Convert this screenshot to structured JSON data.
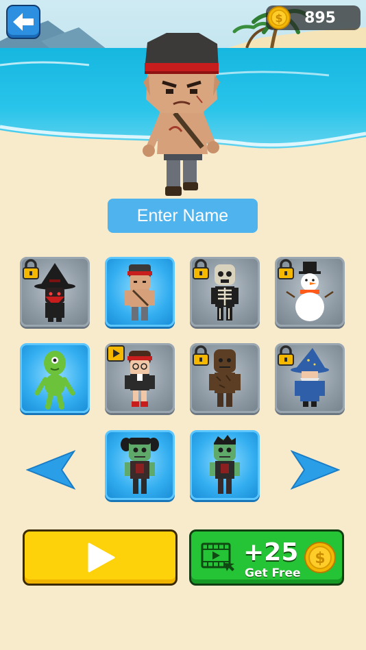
{
  "header": {
    "coin_count": "895",
    "back_icon": "arrow-left-icon",
    "coin_icon": "coin-icon"
  },
  "hero": {
    "character": "bandana-fighter"
  },
  "name_field": {
    "label": "Enter Name"
  },
  "characters": [
    {
      "name": "bandit-witch",
      "state": "locked",
      "unlock": "coins"
    },
    {
      "name": "bandana-fighter",
      "state": "selected",
      "unlock": ""
    },
    {
      "name": "skeleton",
      "state": "locked",
      "unlock": "coins"
    },
    {
      "name": "snowman",
      "state": "locked",
      "unlock": "coins"
    },
    {
      "name": "green-alien",
      "state": "unlocked",
      "unlock": ""
    },
    {
      "name": "schoolgirl",
      "state": "locked",
      "unlock": "video"
    },
    {
      "name": "swamp-creature",
      "state": "locked",
      "unlock": "coins"
    },
    {
      "name": "wizard",
      "state": "locked",
      "unlock": "coins"
    },
    {
      "name": "zombie-girl",
      "state": "unlocked",
      "unlock": ""
    },
    {
      "name": "zombie-boy",
      "state": "unlocked",
      "unlock": ""
    }
  ],
  "nav": {
    "prev_icon": "triangle-left-icon",
    "next_icon": "triangle-right-icon"
  },
  "play_button": {
    "icon": "play-icon"
  },
  "free_coins_button": {
    "reward": "+25",
    "caption": "Get Free",
    "icon": "video-icon"
  },
  "colors": {
    "accent_blue": "#4fb3ee",
    "play_yellow": "#fdd20a",
    "free_green": "#25c436",
    "coin_gold": "#f2b705"
  }
}
